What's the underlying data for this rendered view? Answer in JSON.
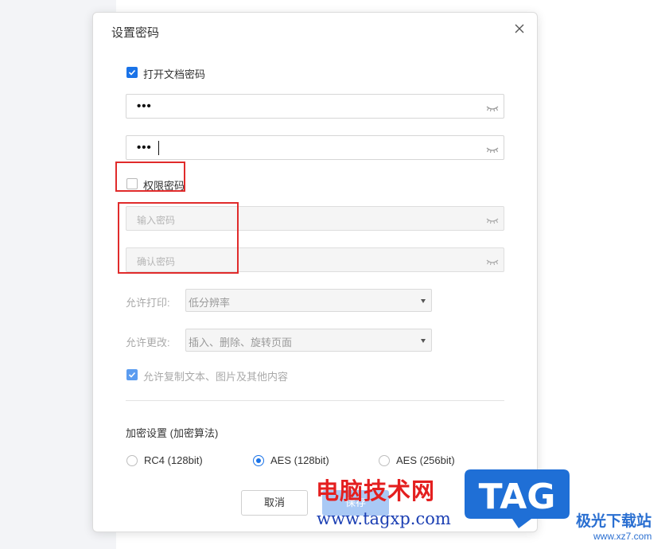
{
  "dialog": {
    "title": "设置密码",
    "open_password": {
      "checkbox_label": "打开文档密码",
      "checked": true,
      "password_mask": "•••",
      "confirm_mask": "•••"
    },
    "permission_password": {
      "checkbox_label": "权限密码",
      "checked": false,
      "input_placeholder": "输入密码",
      "confirm_placeholder": "确认密码"
    },
    "allow_print": {
      "label": "允许打印:",
      "value": "低分辨率"
    },
    "allow_change": {
      "label": "允许更改:",
      "value": "插入、删除、旋转页面"
    },
    "allow_copy": {
      "label": "允许复制文本、图片及其他内容",
      "checked": true
    },
    "encryption": {
      "title": "加密设置 (加密算法)",
      "options": [
        {
          "label": "RC4 (128bit)",
          "selected": false
        },
        {
          "label": "AES (128bit)",
          "selected": true
        },
        {
          "label": "AES (256bit)",
          "selected": false
        }
      ]
    },
    "buttons": {
      "cancel": "取消",
      "save": "保存"
    }
  },
  "watermark": {
    "cn_text": "电脑技术网",
    "url": "www.tagxp.com",
    "logo_text": "TAG",
    "site_name": "极光下载站",
    "site_url": "www.xz7.com"
  },
  "colors": {
    "accent": "#1a73e8",
    "highlight_box": "#e02b2b",
    "logo_blue": "#1f6fd6"
  },
  "icons": [
    "close-icon",
    "eye-closed-icon",
    "check-icon",
    "dropdown-arrow-icon"
  ]
}
